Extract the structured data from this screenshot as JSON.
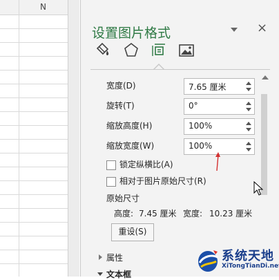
{
  "sheet": {
    "column_label": "N"
  },
  "pane": {
    "title": "设置图片格式",
    "dropdown_icon": "chevron-down-icon",
    "close_label": "×",
    "tabs": [
      {
        "name": "fill-line-tab",
        "icon": "paint-bucket-icon"
      },
      {
        "name": "effects-tab",
        "icon": "pentagon-icon"
      },
      {
        "name": "size-properties-tab",
        "icon": "size-position-icon",
        "selected": true
      },
      {
        "name": "picture-tab",
        "icon": "picture-icon"
      }
    ],
    "size": {
      "width_label": "宽度(D)",
      "width_value": "7.65 厘米",
      "rotation_label": "旋转(T)",
      "rotation_value": "0°",
      "scale_height_label": "缩放高度(H)",
      "scale_height_value": "100%",
      "scale_width_label": "缩放宽度(W)",
      "scale_width_value": "100%",
      "lock_aspect_label": "锁定纵横比(A)",
      "relative_original_label": "相对于图片原始尺寸(R)",
      "original_size_heading": "原始尺寸",
      "original_height_label": "高度:",
      "original_height_value": "7.45 厘米",
      "original_width_label": "宽度:",
      "original_width_value": "10.23 厘米",
      "reset_label": "重设(S)"
    },
    "sections": {
      "properties_label": "属性",
      "textbox_label": "文本框"
    }
  },
  "watermark": {
    "text": "系统天地",
    "url": "XiTongTianDi.net"
  },
  "colors": {
    "title_green": "#2f7a45",
    "annotation_red": "#d32f2f",
    "watermark_blue": "#1b3f8c"
  }
}
